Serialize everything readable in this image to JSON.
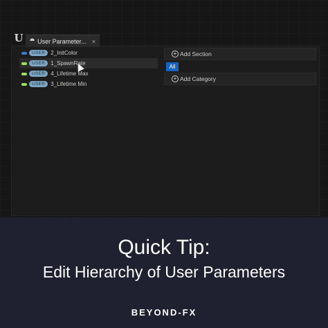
{
  "app": {
    "logo_label": "U"
  },
  "tab": {
    "title": "User Parameter...",
    "close": "×"
  },
  "parameters": [
    {
      "badge": "USER",
      "name": "2_InitColor",
      "pin_color": "#3a7bd5"
    },
    {
      "badge": "USER",
      "name": "1_SpawnRate",
      "pin_color": "#9be05a"
    },
    {
      "badge": "USER",
      "name": "4_Lifetime Max",
      "pin_color": "#9be05a"
    },
    {
      "badge": "USER",
      "name": "3_Lifetime Min",
      "pin_color": "#9be05a"
    }
  ],
  "hierarchy": {
    "add_section": "Add Section",
    "all_label": "All",
    "add_category": "Add Category"
  },
  "banner": {
    "title": "Quick Tip:",
    "subtitle": "Edit Hierarchy of User Parameters",
    "brand": "BEYOND-FX"
  },
  "colors": {
    "accent": "#1565c0",
    "banner_bg": "#1f2130",
    "badge_bg": "#7da6c4"
  }
}
